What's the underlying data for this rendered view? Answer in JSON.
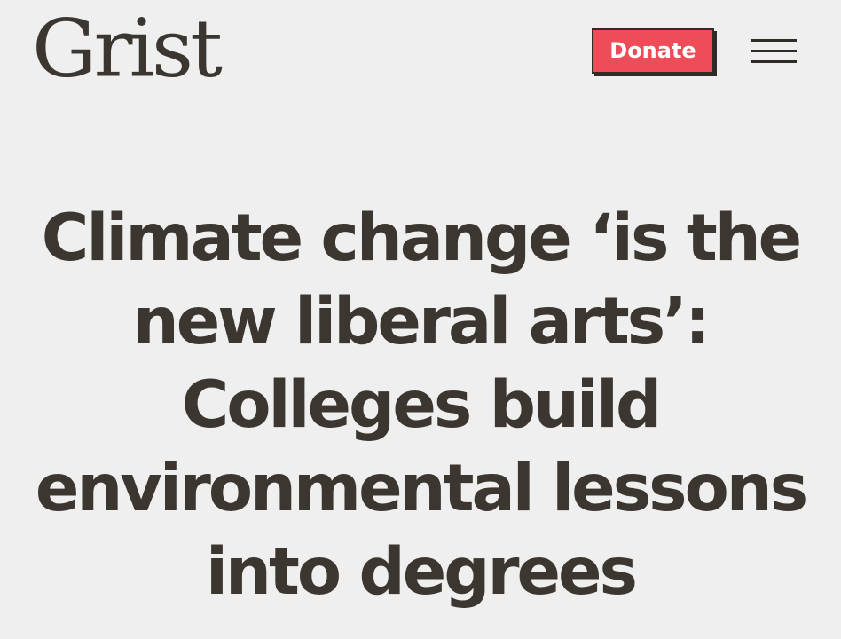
{
  "header": {
    "logo_text": "Grist",
    "donate_label": "Donate",
    "menu_icon": "hamburger-menu-icon"
  },
  "article": {
    "headline": "Climate change ‘is the new liberal arts’: Colleges build environmental lessons into degrees"
  },
  "colors": {
    "background": "#efefef",
    "text": "#3b3630",
    "donate_bg": "#ef4c5a",
    "donate_text": "#ffffff"
  }
}
